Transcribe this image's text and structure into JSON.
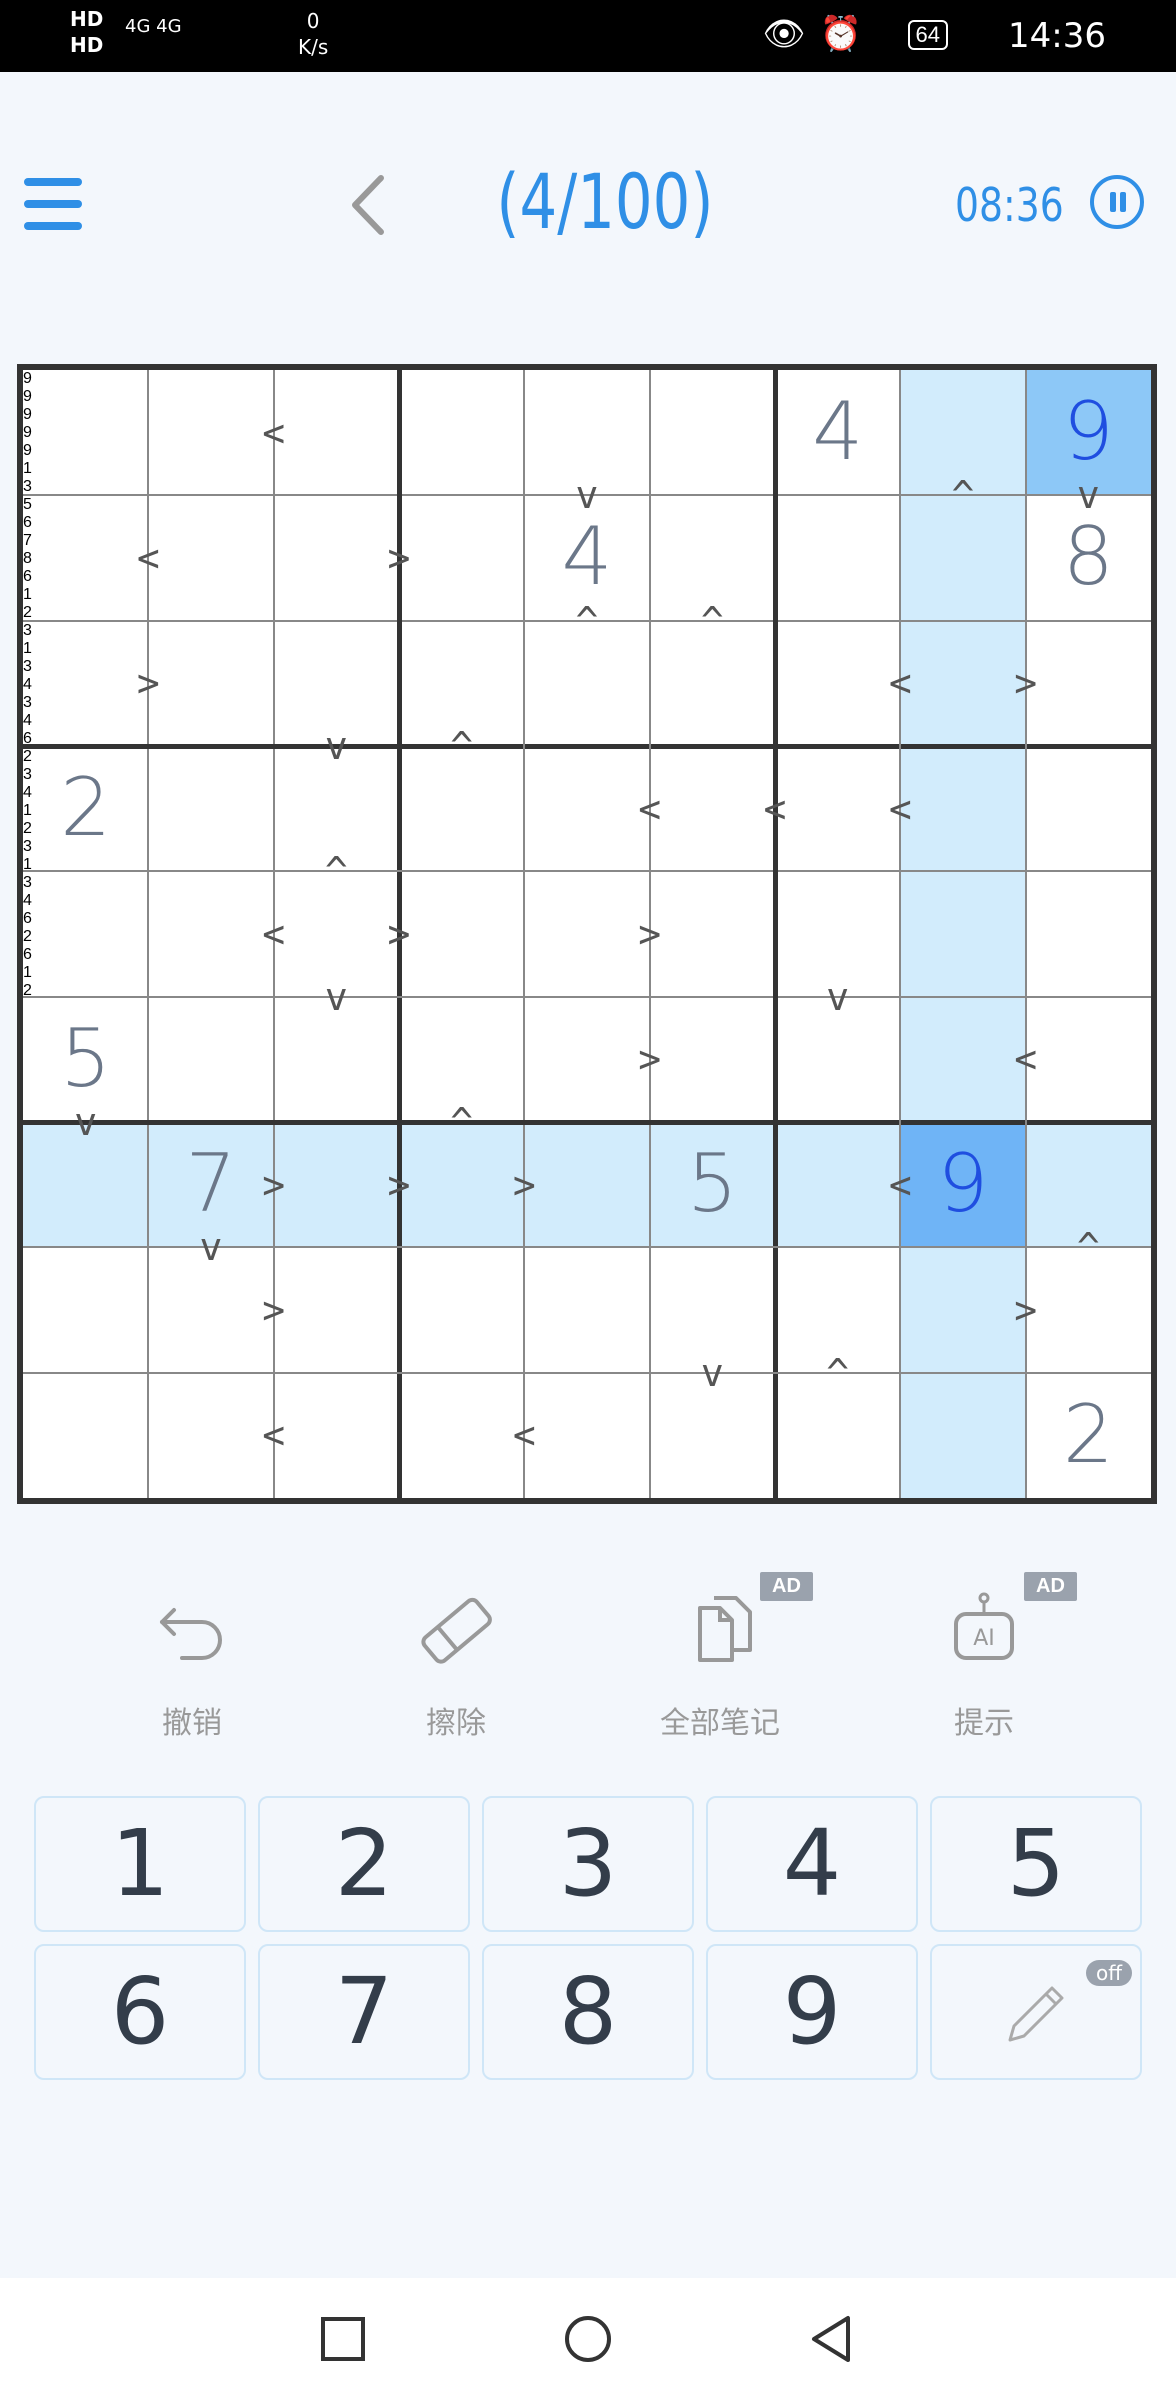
{
  "status_bar": {
    "left_badges": "HD HD",
    "network": "4G 4G",
    "speed_value": "0",
    "speed_unit": "K/s",
    "battery": "64",
    "time": "14:36"
  },
  "header": {
    "title": "(4/100)",
    "timer": "08:36"
  },
  "colors": {
    "accent": "#2f8fe6",
    "highlight": "#d2ecfc",
    "selected": "#6fb4f6",
    "selected_same": "#8dc8f7"
  },
  "board": {
    "cells": [
      [
        "",
        "",
        "",
        "",
        "",
        "",
        "4",
        "",
        "9"
      ],
      [
        "",
        "",
        "",
        "",
        "4",
        "",
        "",
        "",
        "8"
      ],
      [
        "",
        "",
        "",
        "",
        "",
        "",
        "",
        "",
        ""
      ],
      [
        "2",
        "",
        "",
        "",
        "",
        "",
        "",
        "",
        ""
      ],
      [
        "",
        "",
        "",
        "",
        "",
        "",
        "",
        "",
        ""
      ],
      [
        "5",
        "",
        "",
        "",
        "",
        "",
        "",
        "",
        ""
      ],
      [
        "",
        "7",
        "",
        "",
        "",
        "5",
        "",
        "9",
        ""
      ],
      [
        "",
        "",
        "",
        "",
        "",
        "",
        "",
        "",
        ""
      ],
      [
        "",
        "",
        "",
        "",
        "",
        "",
        "",
        "",
        "2"
      ]
    ],
    "notes": [
      {
        "r": 1,
        "c": 1,
        "digits": [
          "9"
        ],
        "orange": true
      },
      {
        "r": 1,
        "c": 2,
        "digits": [
          "9"
        ],
        "orange": true
      },
      {
        "r": 2,
        "c": 4,
        "digits": [
          "9"
        ],
        "orange": true
      },
      {
        "r": 2,
        "c": 5,
        "digits": [
          "9"
        ],
        "orange": true
      },
      {
        "r": 4,
        "c": 6,
        "digits": [
          "9"
        ],
        "orange": true
      },
      {
        "r": 3,
        "c": 4,
        "digits": [
          "1"
        ],
        "orange": false
      },
      {
        "r": 3,
        "c": 5,
        "digits": [
          "3"
        ],
        "orange": false
      },
      {
        "r": 3,
        "c": 6,
        "digits": [
          "5"
        ],
        "orange": false
      },
      {
        "r": 3,
        "c": 7,
        "digits": [
          "6",
          "7",
          "8"
        ],
        "orange": false
      },
      {
        "r": 4,
        "c": 2,
        "digits": [
          "6"
        ],
        "orange": false
      },
      {
        "r": 5,
        "c": 3,
        "digits": [
          "1",
          "2",
          "3"
        ],
        "orange": false
      },
      {
        "r": 6,
        "c": 0,
        "digits": [
          "1",
          "3",
          "4"
        ],
        "orange": false
      },
      {
        "r": 6,
        "c": 2,
        "digits": [
          "3",
          "4",
          "6"
        ],
        "orange": false
      },
      {
        "r": 6,
        "c": 3,
        "digits": [
          "2",
          "3",
          "4"
        ],
        "orange": false
      },
      {
        "r": 6,
        "c": 4,
        "digits": [
          "1",
          "2",
          "3"
        ],
        "orange": false
      },
      {
        "r": 6,
        "c": 8,
        "digits": [
          "1",
          "3",
          "4",
          "6"
        ],
        "orange": false
      },
      {
        "r": 7,
        "c": 1,
        "digits": [
          "2",
          "6"
        ],
        "orange": false
      },
      {
        "r": 7,
        "c": 2,
        "digits": [
          "1",
          "2"
        ],
        "orange": false
      }
    ],
    "inequalities": [
      {
        "r": 0,
        "c": 1,
        "dir": "h",
        "sym": "<"
      },
      {
        "r": 0,
        "c": 4,
        "dir": "v",
        "sym": "v"
      },
      {
        "r": 0,
        "c": 7,
        "dir": "v",
        "sym": "^"
      },
      {
        "r": 0,
        "c": 8,
        "dir": "v",
        "sym": "v"
      },
      {
        "r": 1,
        "c": 0,
        "dir": "h",
        "sym": "<"
      },
      {
        "r": 1,
        "c": 2,
        "dir": "h",
        "sym": ">"
      },
      {
        "r": 1,
        "c": 4,
        "dir": "v",
        "sym": "^"
      },
      {
        "r": 1,
        "c": 5,
        "dir": "v",
        "sym": "^"
      },
      {
        "r": 2,
        "c": 0,
        "dir": "h",
        "sym": ">"
      },
      {
        "r": 2,
        "c": 6,
        "dir": "h",
        "sym": "<"
      },
      {
        "r": 2,
        "c": 7,
        "dir": "h",
        "sym": ">"
      },
      {
        "r": 2,
        "c": 2,
        "dir": "v",
        "sym": "v"
      },
      {
        "r": 2,
        "c": 3,
        "dir": "v",
        "sym": "^"
      },
      {
        "r": 3,
        "c": 4,
        "dir": "h",
        "sym": "<"
      },
      {
        "r": 3,
        "c": 5,
        "dir": "h",
        "sym": "<"
      },
      {
        "r": 3,
        "c": 6,
        "dir": "h",
        "sym": "<"
      },
      {
        "r": 3,
        "c": 2,
        "dir": "v",
        "sym": "^"
      },
      {
        "r": 4,
        "c": 1,
        "dir": "h",
        "sym": "<"
      },
      {
        "r": 4,
        "c": 2,
        "dir": "h",
        "sym": ">"
      },
      {
        "r": 4,
        "c": 4,
        "dir": "h",
        "sym": ">"
      },
      {
        "r": 4,
        "c": 2,
        "dir": "v",
        "sym": "v"
      },
      {
        "r": 4,
        "c": 6,
        "dir": "v",
        "sym": "v"
      },
      {
        "r": 5,
        "c": 4,
        "dir": "h",
        "sym": ">"
      },
      {
        "r": 5,
        "c": 7,
        "dir": "h",
        "sym": "<"
      },
      {
        "r": 5,
        "c": 0,
        "dir": "v",
        "sym": "v"
      },
      {
        "r": 5,
        "c": 3,
        "dir": "v",
        "sym": "^"
      },
      {
        "r": 6,
        "c": 1,
        "dir": "h",
        "sym": ">"
      },
      {
        "r": 6,
        "c": 2,
        "dir": "h",
        "sym": ">"
      },
      {
        "r": 6,
        "c": 3,
        "dir": "h",
        "sym": ">"
      },
      {
        "r": 6,
        "c": 6,
        "dir": "h",
        "sym": "<"
      },
      {
        "r": 6,
        "c": 1,
        "dir": "v",
        "sym": "v"
      },
      {
        "r": 6,
        "c": 8,
        "dir": "v",
        "sym": "^"
      },
      {
        "r": 7,
        "c": 1,
        "dir": "h",
        "sym": ">"
      },
      {
        "r": 7,
        "c": 7,
        "dir": "h",
        "sym": ">"
      },
      {
        "r": 7,
        "c": 5,
        "dir": "v",
        "sym": "v"
      },
      {
        "r": 7,
        "c": 6,
        "dir": "v",
        "sym": "^"
      },
      {
        "r": 8,
        "c": 1,
        "dir": "h",
        "sym": "<"
      },
      {
        "r": 8,
        "c": 3,
        "dir": "h",
        "sym": "<"
      }
    ],
    "selected": {
      "r": 6,
      "c": 7
    },
    "same_value": [
      {
        "r": 0,
        "c": 8
      }
    ]
  },
  "toolbar": {
    "undo": "撤销",
    "erase": "擦除",
    "all_notes": "全部笔记",
    "hint": "提示",
    "ad_badge": "AD"
  },
  "keypad": {
    "keys": [
      "1",
      "2",
      "3",
      "4",
      "5",
      "6",
      "7",
      "8",
      "9"
    ],
    "pencil_state": "off"
  }
}
